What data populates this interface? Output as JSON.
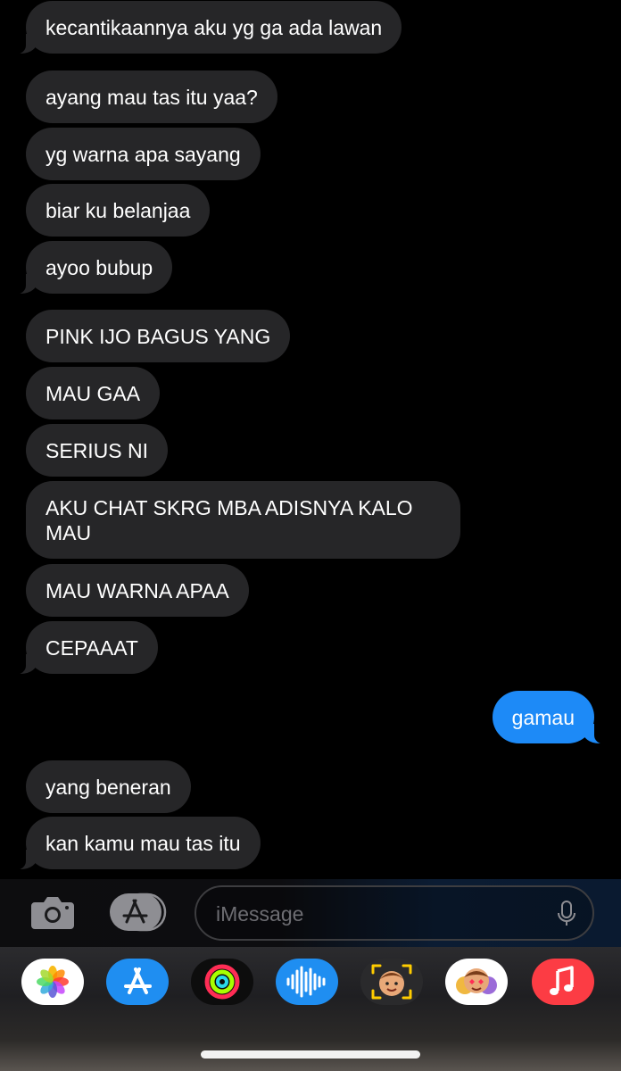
{
  "messages": [
    {
      "text": "kecantikaannya aku yg ga ada lawan",
      "from": "them"
    },
    {
      "text": "ayang mau tas itu yaa?",
      "from": "them"
    },
    {
      "text": "yg warna apa sayang",
      "from": "them"
    },
    {
      "text": "biar ku belanjaa",
      "from": "them"
    },
    {
      "text": "ayoo bubup",
      "from": "them"
    },
    {
      "text": "PINK IJO BAGUS YANG",
      "from": "them"
    },
    {
      "text": "MAU GAA",
      "from": "them"
    },
    {
      "text": "SERIUS NI",
      "from": "them"
    },
    {
      "text": "AKU CHAT SKRG MBA ADISNYA KALO MAU",
      "from": "them"
    },
    {
      "text": "MAU WARNA APAA",
      "from": "them"
    },
    {
      "text": "CEPAAAT",
      "from": "them"
    },
    {
      "text": "gamau",
      "from": "me"
    },
    {
      "text": "yang beneran",
      "from": "them"
    },
    {
      "text": "kan kamu mau tas itu",
      "from": "them"
    }
  ],
  "composer": {
    "placeholder": "iMessage"
  },
  "icons": {
    "camera": "camera-icon",
    "apps": "app-store-icon",
    "mic": "microphone-icon"
  },
  "app_drawer": [
    {
      "name": "Photos",
      "icon": "photos-icon"
    },
    {
      "name": "App Store",
      "icon": "app-store-icon"
    },
    {
      "name": "Activity",
      "icon": "activity-rings-icon"
    },
    {
      "name": "Audio Message",
      "icon": "audio-waveform-icon"
    },
    {
      "name": "Memoji",
      "icon": "memoji-icon"
    },
    {
      "name": "Memoji Stickers",
      "icon": "memoji-stickers-icon"
    },
    {
      "name": "Music",
      "icon": "music-icon"
    }
  ],
  "colors": {
    "incoming_bubble": "#262628",
    "outgoing_bubble": "#1d8af7",
    "background": "#000000"
  }
}
